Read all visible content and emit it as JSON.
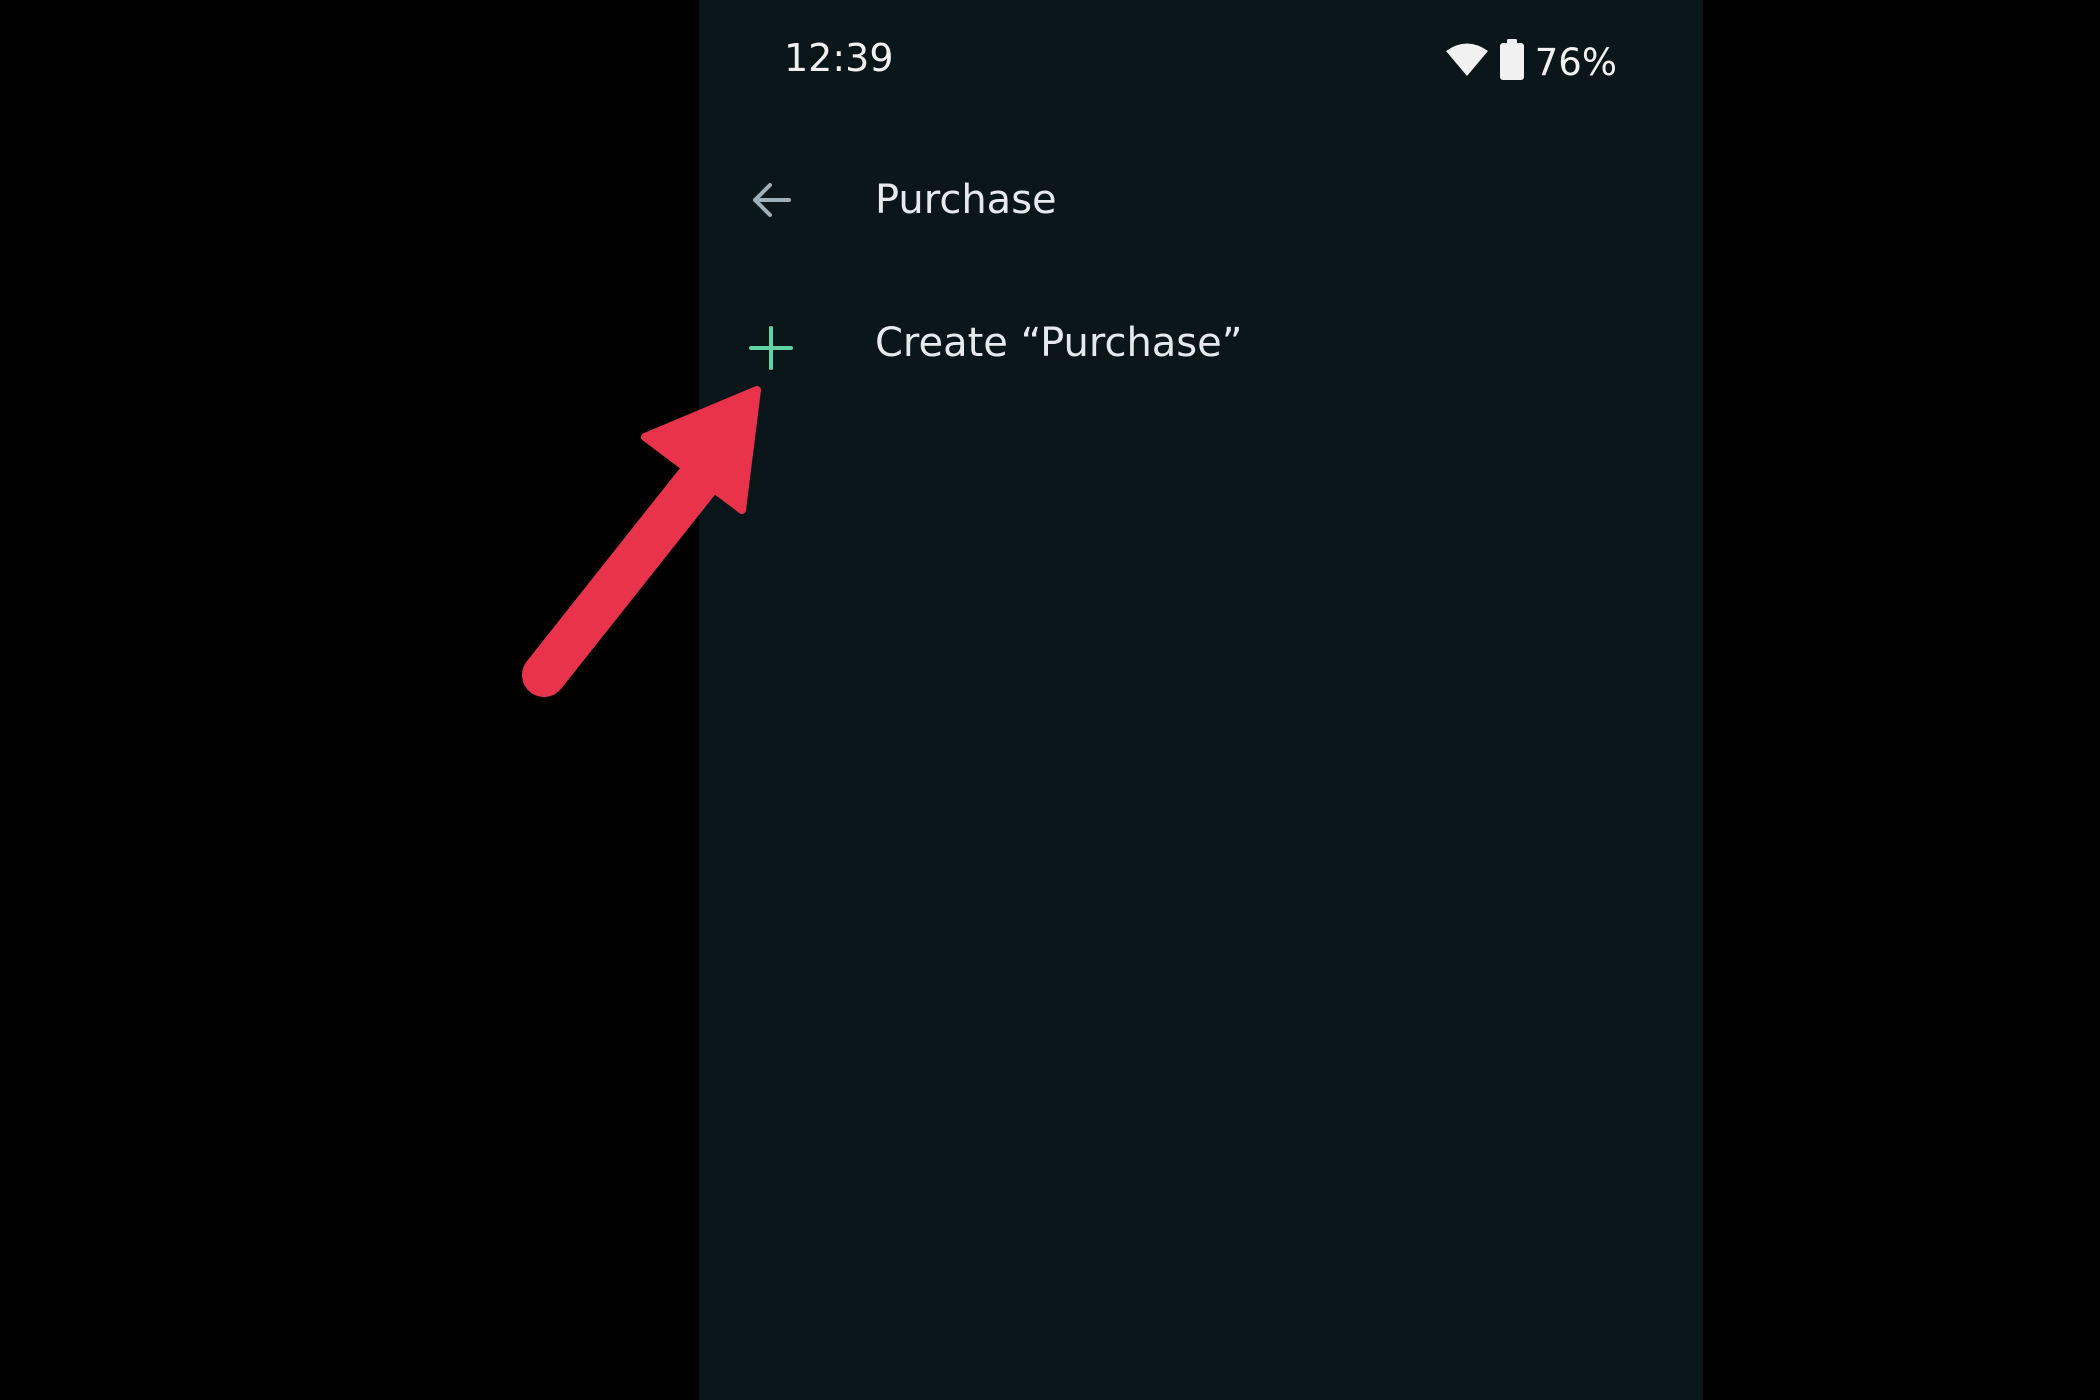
{
  "status_bar": {
    "time": "12:39",
    "wifi_icon": "wifi-icon",
    "battery_icon": "battery-icon",
    "battery_percent": "76%"
  },
  "search": {
    "back_icon": "arrow-left-icon",
    "value": "Purchase"
  },
  "create_option": {
    "icon": "plus-icon",
    "label": "Create “Purchase”"
  },
  "annotation": {
    "icon": "arrow-pointer-icon",
    "color": "#e8334a"
  },
  "colors": {
    "background": "#000000",
    "panel": "#0b161b",
    "accent": "#5fd3a4",
    "text": "#e6eaec",
    "icon_muted": "#9fb0b8"
  }
}
